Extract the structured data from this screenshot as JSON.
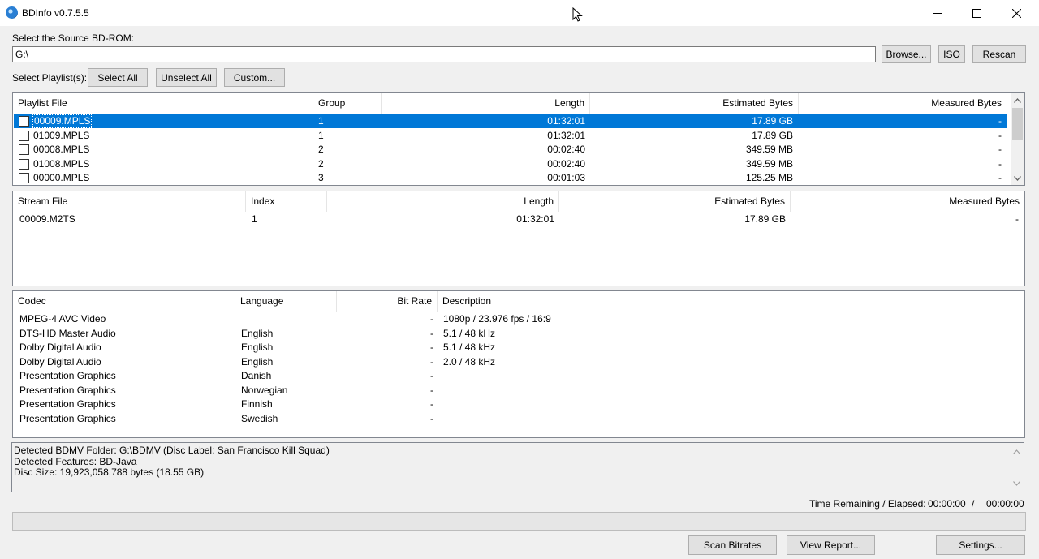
{
  "window": {
    "title": "BDInfo v0.7.5.5"
  },
  "source": {
    "label": "Select the Source BD-ROM:",
    "path": "G:\\",
    "browse": "Browse...",
    "iso": "ISO",
    "rescan": "Rescan"
  },
  "playlist_controls": {
    "label": "Select Playlist(s):",
    "select_all": "Select All",
    "unselect_all": "Unselect All",
    "custom": "Custom..."
  },
  "playlists": {
    "headers": {
      "file": "Playlist File",
      "group": "Group",
      "length": "Length",
      "est": "Estimated Bytes",
      "meas": "Measured Bytes"
    },
    "rows": [
      {
        "file": "00009.MPLS",
        "group": "1",
        "length": "01:32:01",
        "est": "17.89 GB",
        "meas": "-"
      },
      {
        "file": "01009.MPLS",
        "group": "1",
        "length": "01:32:01",
        "est": "17.89 GB",
        "meas": "-"
      },
      {
        "file": "00008.MPLS",
        "group": "2",
        "length": "00:02:40",
        "est": "349.59 MB",
        "meas": "-"
      },
      {
        "file": "01008.MPLS",
        "group": "2",
        "length": "00:02:40",
        "est": "349.59 MB",
        "meas": "-"
      },
      {
        "file": "00000.MPLS",
        "group": "3",
        "length": "00:01:03",
        "est": "125.25 MB",
        "meas": "-"
      }
    ]
  },
  "streams": {
    "headers": {
      "file": "Stream File",
      "index": "Index",
      "length": "Length",
      "est": "Estimated Bytes",
      "meas": "Measured Bytes"
    },
    "rows": [
      {
        "file": "00009.M2TS",
        "index": "1",
        "length": "01:32:01",
        "est": "17.89 GB",
        "meas": "-"
      }
    ]
  },
  "codecs": {
    "headers": {
      "codec": "Codec",
      "language": "Language",
      "bitrate": "Bit Rate",
      "description": "Description"
    },
    "rows": [
      {
        "codec": "MPEG-4 AVC Video",
        "language": "",
        "bitrate": "-",
        "description": "1080p / 23.976 fps / 16:9"
      },
      {
        "codec": "DTS-HD Master Audio",
        "language": "English",
        "bitrate": "-",
        "description": "5.1 / 48 kHz"
      },
      {
        "codec": "Dolby Digital Audio",
        "language": "English",
        "bitrate": "-",
        "description": "5.1 / 48 kHz"
      },
      {
        "codec": "Dolby Digital Audio",
        "language": "English",
        "bitrate": "-",
        "description": "2.0 / 48 kHz"
      },
      {
        "codec": "Presentation Graphics",
        "language": "Danish",
        "bitrate": "-",
        "description": ""
      },
      {
        "codec": "Presentation Graphics",
        "language": "Norwegian",
        "bitrate": "-",
        "description": ""
      },
      {
        "codec": "Presentation Graphics",
        "language": "Finnish",
        "bitrate": "-",
        "description": ""
      },
      {
        "codec": "Presentation Graphics",
        "language": "Swedish",
        "bitrate": "-",
        "description": ""
      }
    ]
  },
  "info": {
    "line1": "Detected BDMV Folder: G:\\BDMV (Disc Label: San Francisco Kill Squad)",
    "line2": "Detected Features: BD-Java",
    "line3": "Disc Size: 19,923,058,788 bytes (18.55 GB)"
  },
  "status": {
    "time_label": "Time Remaining / Elapsed:",
    "remaining": "00:00:00",
    "slash": "/",
    "elapsed": "00:00:00",
    "progress": 0
  },
  "footer": {
    "scan": "Scan Bitrates",
    "report": "View Report...",
    "settings": "Settings..."
  },
  "colors": {
    "selection": "#0078d7",
    "window_bg": "#f0f0f0"
  },
  "icons": {
    "app": "bdinfo-disc-icon",
    "cursor": "mouse-pointer-icon",
    "minimize": "minimize-icon",
    "maximize": "maximize-icon",
    "close": "close-icon",
    "up": "chevron-up-icon",
    "down": "chevron-down-icon"
  }
}
